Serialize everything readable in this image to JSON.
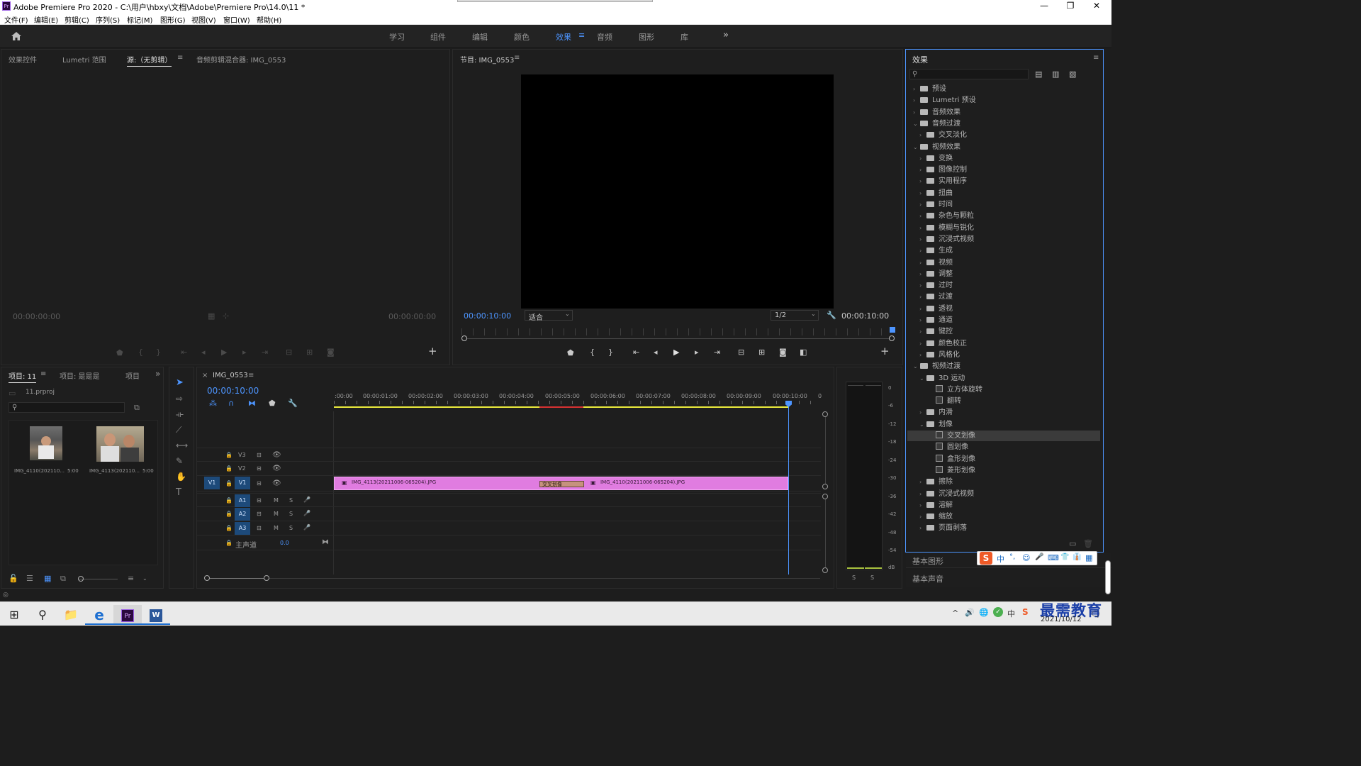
{
  "titlebar": {
    "logo": "Pr",
    "title": "Adobe Premiere Pro 2020 - C:\\用户\\hbxy\\文档\\Adobe\\Premiere Pro\\14.0\\11 *",
    "minimize": "—",
    "maximize": "❐",
    "close": "✕"
  },
  "menu": [
    "文件(F)",
    "编辑(E)",
    "剪辑(C)",
    "序列(S)",
    "标记(M)",
    "图形(G)",
    "视图(V)",
    "窗口(W)",
    "帮助(H)"
  ],
  "workspaces": [
    "学习",
    "组件",
    "编辑",
    "颜色",
    "效果",
    "音频",
    "图形",
    "库"
  ],
  "active_workspace": "效果",
  "source_panel": {
    "tabs": [
      "效果控件",
      "Lumetri 范围",
      "源:（无剪辑）",
      "音频剪辑混合器: IMG_0553"
    ],
    "active_tab": "源:（无剪辑）",
    "timecode_left": "00:00:00:00",
    "timecode_right": "00:00:00:00"
  },
  "program_panel": {
    "tab": "节目: IMG_0553",
    "timecode": "00:00:10:00",
    "fit": "适合",
    "resolution": "1/2",
    "duration": "00:00:10:00"
  },
  "project_panel": {
    "tabs": [
      "项目: 11",
      "项目: 是是是",
      "项目"
    ],
    "file": "11.prproj",
    "items": [
      {
        "name": "IMG_4110(202110...",
        "duration": "5:00"
      },
      {
        "name": "IMG_4113(202110...",
        "duration": "5:00"
      }
    ]
  },
  "timeline": {
    "tab": "IMG_0553",
    "close": "×",
    "timecode": "00:00:10:00",
    "ruler": [
      ":00:00",
      "00:00:01:00",
      "00:00:02:00",
      "00:00:03:00",
      "00:00:04:00",
      "00:00:05:00",
      "00:00:06:00",
      "00:00:07:00",
      "00:00:08:00",
      "00:00:09:00",
      "00:00:10:00",
      "0"
    ],
    "video_tracks": [
      "V3",
      "V2",
      "V1"
    ],
    "source_patch": "V1",
    "audio_tracks": [
      "A1",
      "A2",
      "A3"
    ],
    "master_label": "主声道",
    "master_value": "0.0",
    "mute": "M",
    "solo": "S",
    "clip1": "IMG_4113(20211006-065204).JPG",
    "clip2": "IMG_4110(20211006-065204).JPG",
    "transition": "交叉划像",
    "clip_color": "#e07ce0"
  },
  "audio_meter": {
    "scale": [
      "0",
      "-6",
      "-12",
      "-18",
      "-24",
      "-30",
      "-36",
      "-42",
      "-48",
      "-54",
      "dB"
    ],
    "solo_left": "S",
    "solo_right": "S"
  },
  "effects_panel": {
    "title": "效果",
    "items": [
      {
        "label": "预设",
        "level": 0,
        "arrow": "›",
        "kind": "folder-star"
      },
      {
        "label": "Lumetri 预设",
        "level": 0,
        "arrow": "›",
        "kind": "folder-star"
      },
      {
        "label": "音频效果",
        "level": 0,
        "arrow": "›",
        "kind": "folder"
      },
      {
        "label": "音频过渡",
        "level": 0,
        "arrow": "⌄",
        "kind": "folder"
      },
      {
        "label": "交叉淡化",
        "level": 1,
        "arrow": "›",
        "kind": "folder"
      },
      {
        "label": "视频效果",
        "level": 0,
        "arrow": "⌄",
        "kind": "folder"
      },
      {
        "label": "变换",
        "level": 1,
        "arrow": "›",
        "kind": "folder"
      },
      {
        "label": "图像控制",
        "level": 1,
        "arrow": "›",
        "kind": "folder"
      },
      {
        "label": "实用程序",
        "level": 1,
        "arrow": "›",
        "kind": "folder"
      },
      {
        "label": "扭曲",
        "level": 1,
        "arrow": "›",
        "kind": "folder"
      },
      {
        "label": "时间",
        "level": 1,
        "arrow": "›",
        "kind": "folder"
      },
      {
        "label": "杂色与颗粒",
        "level": 1,
        "arrow": "›",
        "kind": "folder"
      },
      {
        "label": "模糊与锐化",
        "level": 1,
        "arrow": "›",
        "kind": "folder"
      },
      {
        "label": "沉浸式视频",
        "level": 1,
        "arrow": "›",
        "kind": "folder"
      },
      {
        "label": "生成",
        "level": 1,
        "arrow": "›",
        "kind": "folder"
      },
      {
        "label": "视频",
        "level": 1,
        "arrow": "›",
        "kind": "folder"
      },
      {
        "label": "调整",
        "level": 1,
        "arrow": "›",
        "kind": "folder"
      },
      {
        "label": "过时",
        "level": 1,
        "arrow": "›",
        "kind": "folder"
      },
      {
        "label": "过渡",
        "level": 1,
        "arrow": "›",
        "kind": "folder"
      },
      {
        "label": "透视",
        "level": 1,
        "arrow": "›",
        "kind": "folder"
      },
      {
        "label": "通道",
        "level": 1,
        "arrow": "›",
        "kind": "folder"
      },
      {
        "label": "键控",
        "level": 1,
        "arrow": "›",
        "kind": "folder"
      },
      {
        "label": "颜色校正",
        "level": 1,
        "arrow": "›",
        "kind": "folder"
      },
      {
        "label": "风格化",
        "level": 1,
        "arrow": "›",
        "kind": "folder"
      },
      {
        "label": "视频过渡",
        "level": 0,
        "arrow": "⌄",
        "kind": "folder"
      },
      {
        "label": "3D 运动",
        "level": 1,
        "arrow": "⌄",
        "kind": "folder"
      },
      {
        "label": "立方体旋转",
        "level": 2,
        "arrow": "",
        "kind": "fx"
      },
      {
        "label": "翻转",
        "level": 2,
        "arrow": "",
        "kind": "fx"
      },
      {
        "label": "内滑",
        "level": 1,
        "arrow": "›",
        "kind": "folder"
      },
      {
        "label": "划像",
        "level": 1,
        "arrow": "⌄",
        "kind": "folder"
      },
      {
        "label": "交叉划像",
        "level": 2,
        "arrow": "",
        "kind": "fx",
        "selected": true
      },
      {
        "label": "圆划像",
        "level": 2,
        "arrow": "",
        "kind": "fx"
      },
      {
        "label": "盒形划像",
        "level": 2,
        "arrow": "",
        "kind": "fx"
      },
      {
        "label": "菱形划像",
        "level": 2,
        "arrow": "",
        "kind": "fx"
      },
      {
        "label": "擦除",
        "level": 1,
        "arrow": "›",
        "kind": "folder"
      },
      {
        "label": "沉浸式视频",
        "level": 1,
        "arrow": "›",
        "kind": "folder"
      },
      {
        "label": "溶解",
        "level": 1,
        "arrow": "›",
        "kind": "folder"
      },
      {
        "label": "缩放",
        "level": 1,
        "arrow": "›",
        "kind": "folder"
      },
      {
        "label": "页面剥落",
        "level": 1,
        "arrow": "›",
        "kind": "folder"
      }
    ],
    "basic_graphics": "基本图形",
    "basic_sound": "基本声音"
  },
  "ime_bar": [
    "S",
    "中",
    "°,",
    "☺",
    "🎤",
    "⌨",
    "👕",
    "👔",
    "▦"
  ],
  "taskbar": {
    "apps": [
      "⊞",
      "⚲",
      "📁",
      "e",
      "Pr",
      "W"
    ],
    "date": "2021/10/12",
    "watermark": "最需教育",
    "tray": [
      "^",
      "🔊",
      "🌐",
      "✓",
      "中",
      "S"
    ]
  },
  "colors": {
    "accent": "#4d95ff",
    "clip": "#e07ce0",
    "transition": "#c6927d",
    "playhead": "#4d95ff",
    "workarea": "#ebeb3c",
    "render_red": "#d83232"
  }
}
